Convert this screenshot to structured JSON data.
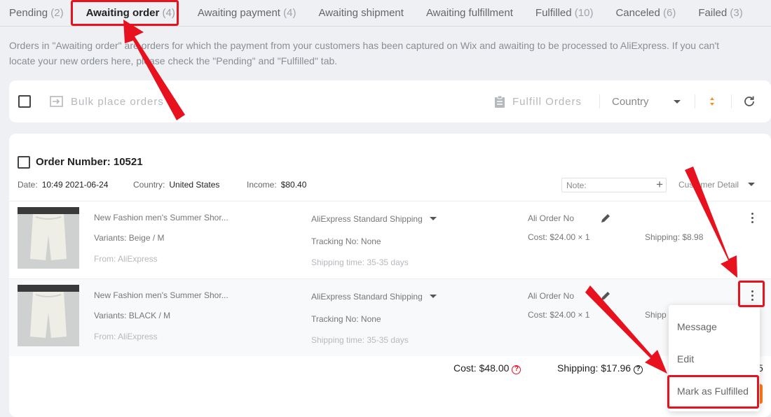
{
  "tabs": [
    {
      "label": "Pending",
      "count": "(2)"
    },
    {
      "label": "Awaiting order",
      "count": "(4)"
    },
    {
      "label": "Awaiting payment",
      "count": "(4)"
    },
    {
      "label": "Awaiting shipment",
      "count": ""
    },
    {
      "label": "Awaiting fulfillment",
      "count": ""
    },
    {
      "label": "Fulfilled",
      "count": "(10)"
    },
    {
      "label": "Canceled",
      "count": "(6)"
    },
    {
      "label": "Failed",
      "count": "(3)"
    }
  ],
  "description_line1": "Orders in \"Awaiting order\" are orders for which the payment from your customers has been captured on Wix and awaiting to be processed to AliExpress. If you can't",
  "description_line2": "locate your new orders here, please check the \"Pending\" and \"Fulfilled\" tab.",
  "toolbar": {
    "bulk_label": "Bulk place orders",
    "fulfill_label": "Fulfill Orders",
    "country_label": "Country"
  },
  "order": {
    "title": "Order Number: 10521",
    "date_label": "Date:",
    "date_value": "10:49 2021-06-24",
    "country_label": "Country:",
    "country_value": "United States",
    "income_label": "Income:",
    "income_value": "$80.40",
    "note_placeholder": "Note:",
    "customer_detail": "Customer Detail",
    "items": [
      {
        "title": "New Fashion men's Summer Shor...",
        "variants": "Variants: Beige / M",
        "from": "From: AliExpress",
        "shipping_method": "AliExpress Standard Shipping",
        "tracking": "Tracking No: None",
        "shipping_time": "Shipping time: 35-35 days",
        "ali_order": "Ali Order No",
        "cost": "Cost: $24.00 × 1",
        "shipping": "Shipping: $8.98"
      },
      {
        "title": "New Fashion men's Summer Shor...",
        "variants": "Variants: BLACK / M",
        "from": "From: AliExpress",
        "shipping_method": "AliExpress Standard Shipping",
        "tracking": "Tracking No: None",
        "shipping_time": "Shipping time: 35-35 days",
        "ali_order": "Ali Order No",
        "cost": "Cost: $24.00 × 1",
        "shipping": "Shipp"
      }
    ],
    "total_cost": "Cost: $48.00",
    "total_shipping": "Shipping: $17.96",
    "total_partial": "5"
  },
  "menu": {
    "message": "Message",
    "edit": "Edit",
    "mark_fulfilled": "Mark as Fulfilled"
  },
  "colors": {
    "accent_orange": "#ff7a1a",
    "annotation_red": "#e8111e"
  }
}
